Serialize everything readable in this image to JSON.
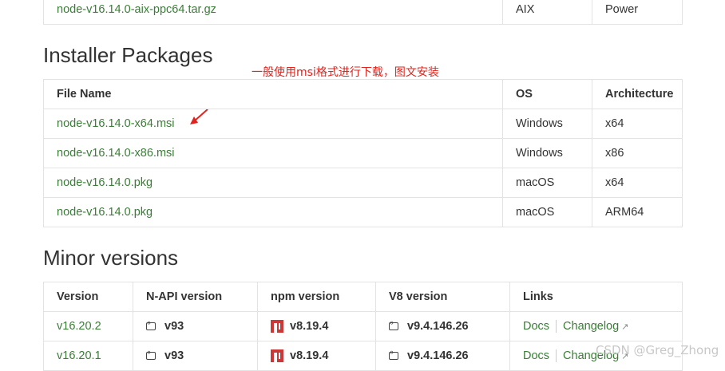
{
  "top_row": {
    "file": "node-v16.14.0-aix-ppc64.tar.gz",
    "os": "AIX",
    "arch": "Power"
  },
  "installer": {
    "heading": "Installer Packages",
    "annotation": "一般使用msi格式进行下载，图文安装",
    "headers": {
      "file": "File Name",
      "os": "OS",
      "arch": "Architecture"
    },
    "rows": [
      {
        "file": "node-v16.14.0-x64.msi",
        "os": "Windows",
        "arch": "x64"
      },
      {
        "file": "node-v16.14.0-x86.msi",
        "os": "Windows",
        "arch": "x86"
      },
      {
        "file": "node-v16.14.0.pkg",
        "os": "macOS",
        "arch": "x64"
      },
      {
        "file": "node-v16.14.0.pkg",
        "os": "macOS",
        "arch": "ARM64"
      }
    ]
  },
  "minor": {
    "heading": "Minor versions",
    "headers": {
      "version": "Version",
      "napi": "N-API version",
      "npm": "npm version",
      "v8": "V8 version",
      "links": "Links"
    },
    "rows": [
      {
        "version": "v16.20.2",
        "napi": "v93",
        "npm": "v8.19.4",
        "v8": "v9.4.146.26",
        "docs": "Docs",
        "changelog": "Changelog"
      },
      {
        "version": "v16.20.1",
        "napi": "v93",
        "npm": "v8.19.4",
        "v8": "v9.4.146.26",
        "docs": "Docs",
        "changelog": "Changelog"
      }
    ]
  },
  "watermark": "CSDN @Greg_Zhong",
  "colors": {
    "link": "#3a7d37",
    "annotation": "#e0241d",
    "npm": "#cb3837",
    "border": "#e3e3e3"
  },
  "icons": {
    "arrow": "red-arrow-icon",
    "napi": "code-bracket-icon",
    "npm": "npm-logo-icon",
    "v8": "code-bracket-icon",
    "external": "external-link-icon"
  }
}
